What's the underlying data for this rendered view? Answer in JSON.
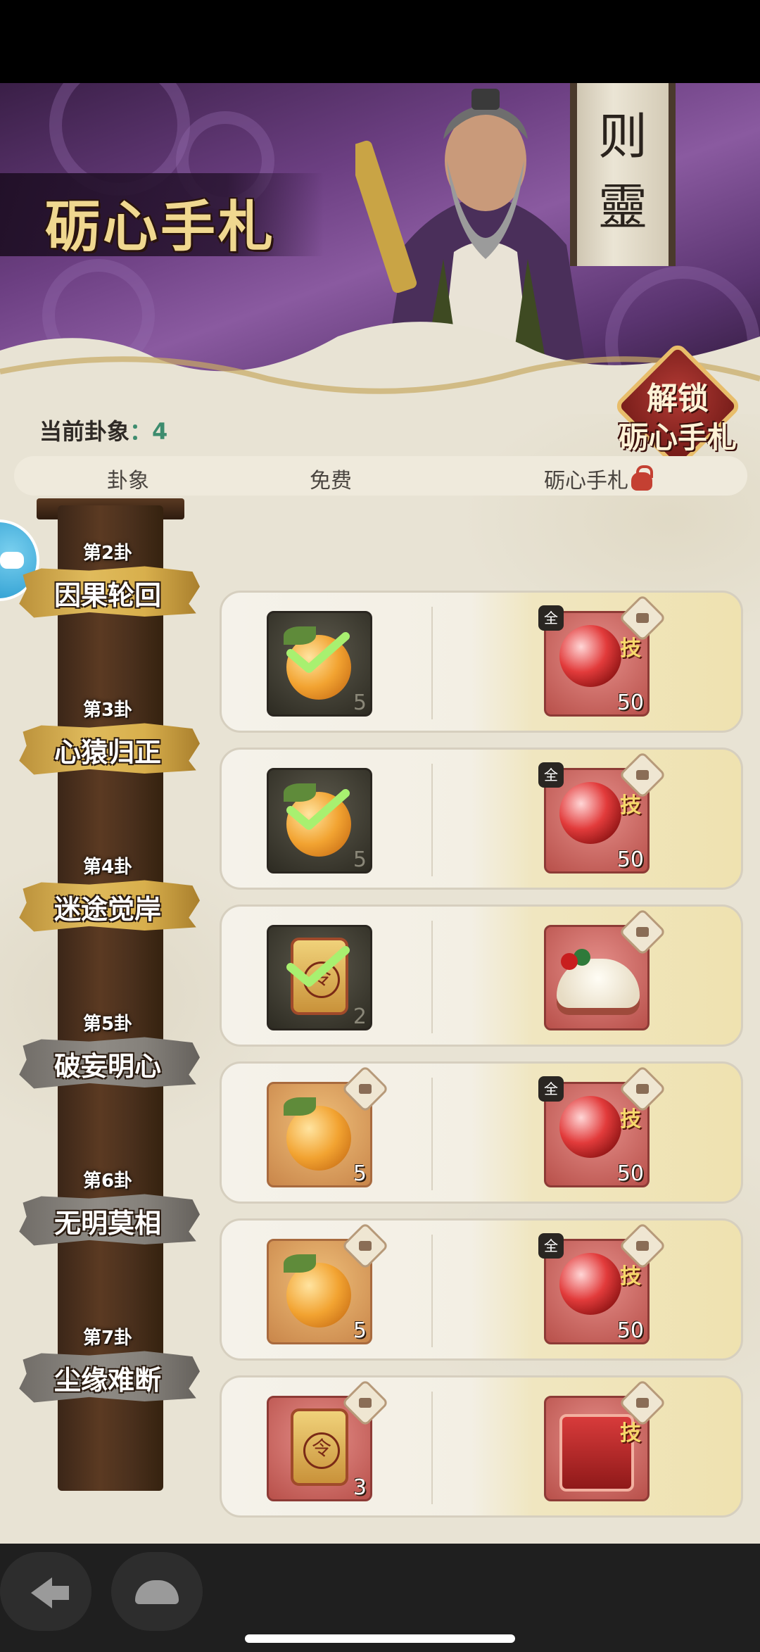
{
  "banner": {
    "title": "砺心手札",
    "scroll_chars": [
      "则",
      "靈"
    ],
    "unlock_line1": "解锁",
    "unlock_line2": "砺心手札"
  },
  "status": {
    "current_label": "当前卦象",
    "current_sep": "：",
    "current_value": "4"
  },
  "columns": {
    "hexagram": "卦象",
    "free": "免费",
    "premium": "砺心手札"
  },
  "stages": [
    {
      "num": "第2卦",
      "name": "因果轮回",
      "style": "gold",
      "free": {
        "item": "fruit",
        "count": "5",
        "claimed": true
      },
      "paid": {
        "item": "skill-orb",
        "count": "50",
        "badge": "技",
        "all_tag": "全",
        "locked": true
      }
    },
    {
      "num": "第3卦",
      "name": "心猿归正",
      "style": "gold",
      "free": {
        "item": "fruit",
        "count": "5",
        "claimed": true
      },
      "paid": {
        "item": "skill-orb",
        "count": "50",
        "badge": "技",
        "all_tag": "全",
        "locked": true
      }
    },
    {
      "num": "第4卦",
      "name": "迷途觉岸",
      "style": "gold",
      "free": {
        "item": "token",
        "count": "2",
        "claimed": true
      },
      "paid": {
        "item": "dumplings",
        "count": "",
        "badge": "",
        "all_tag": "",
        "locked": true
      }
    },
    {
      "num": "第5卦",
      "name": "破妄明心",
      "style": "gray",
      "free": {
        "item": "fruit",
        "count": "5",
        "claimed": false,
        "locked": true
      },
      "paid": {
        "item": "skill-orb",
        "count": "50",
        "badge": "技",
        "all_tag": "全",
        "locked": true
      }
    },
    {
      "num": "第6卦",
      "name": "无明莫相",
      "style": "gray",
      "free": {
        "item": "fruit",
        "count": "5",
        "claimed": false,
        "locked": true
      },
      "paid": {
        "item": "skill-orb",
        "count": "50",
        "badge": "技",
        "all_tag": "全",
        "locked": true
      }
    },
    {
      "num": "第7卦",
      "name": "尘缘难断",
      "style": "gray",
      "free": {
        "item": "token",
        "count": "3",
        "claimed": false,
        "locked": true
      },
      "paid": {
        "item": "red-chest",
        "count": "",
        "badge": "技",
        "all_tag": "",
        "locked": true
      }
    }
  ],
  "icons": {
    "back": "back-arrow-icon",
    "home": "home-cat-icon",
    "float": "gamepad-icon"
  },
  "colors": {
    "accent_gold": "#e0bb5c",
    "current_value": "#3d8c6e",
    "banner_purple": "#6c3f82"
  }
}
